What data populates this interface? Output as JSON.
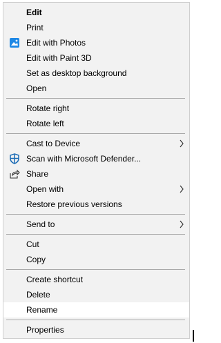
{
  "menu": {
    "edit": "Edit",
    "print": "Print",
    "edit_photos": "Edit with Photos",
    "edit_paint3d": "Edit with Paint 3D",
    "set_desktop": "Set as desktop background",
    "open": "Open",
    "rotate_right": "Rotate right",
    "rotate_left": "Rotate left",
    "cast": "Cast to Device",
    "scan": "Scan with Microsoft Defender...",
    "share": "Share",
    "open_with": "Open with",
    "restore": "Restore previous versions",
    "send_to": "Send to",
    "cut": "Cut",
    "copy": "Copy",
    "create_shortcut": "Create shortcut",
    "delete": "Delete",
    "rename": "Rename",
    "properties": "Properties"
  },
  "icons": {
    "photos": "photos-app-icon",
    "defender": "microsoft-defender-icon",
    "share": "share-icon",
    "submenu_arrow": "chevron-right-icon"
  },
  "colors": {
    "menu_bg": "#f2f2f2",
    "highlight_bg": "#ffffff",
    "separator": "#a9a9a9",
    "defender_blue": "#1a6bb5",
    "photos_blue": "#1e88e5"
  }
}
